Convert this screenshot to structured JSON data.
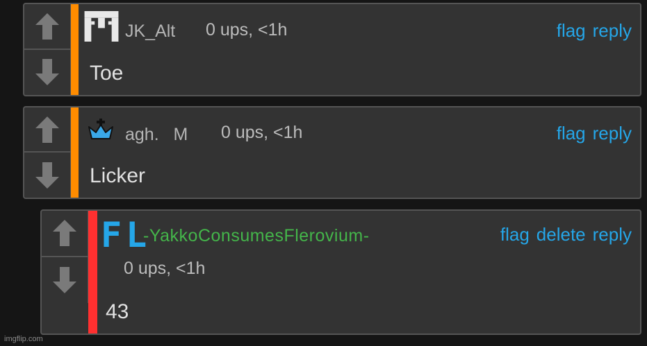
{
  "comments": [
    {
      "username": "JK_Alt",
      "ups": "0 ups, <1h",
      "actions": [
        "flag",
        "reply"
      ],
      "text": "Toe",
      "stripe_color": "#ff8c00",
      "avatar_icon": "pixel-logo-icon"
    },
    {
      "username": "agh.   M",
      "ups": "0 ups, <1h",
      "actions": [
        "flag",
        "reply"
      ],
      "text": "Licker",
      "stripe_color": "#ff8c00",
      "avatar_icon": "crown-icon"
    },
    {
      "username": "-YakkoConsumesFlerovium-",
      "username_color": "#44b54a",
      "ups": "0 ups, <1h",
      "actions": [
        "flag",
        "delete",
        "reply"
      ],
      "text": "43",
      "stripe_color": "#ff3030",
      "avatar_text": "FL",
      "avatar_color": "#25a6e8"
    }
  ],
  "watermark": "imgflip.com"
}
